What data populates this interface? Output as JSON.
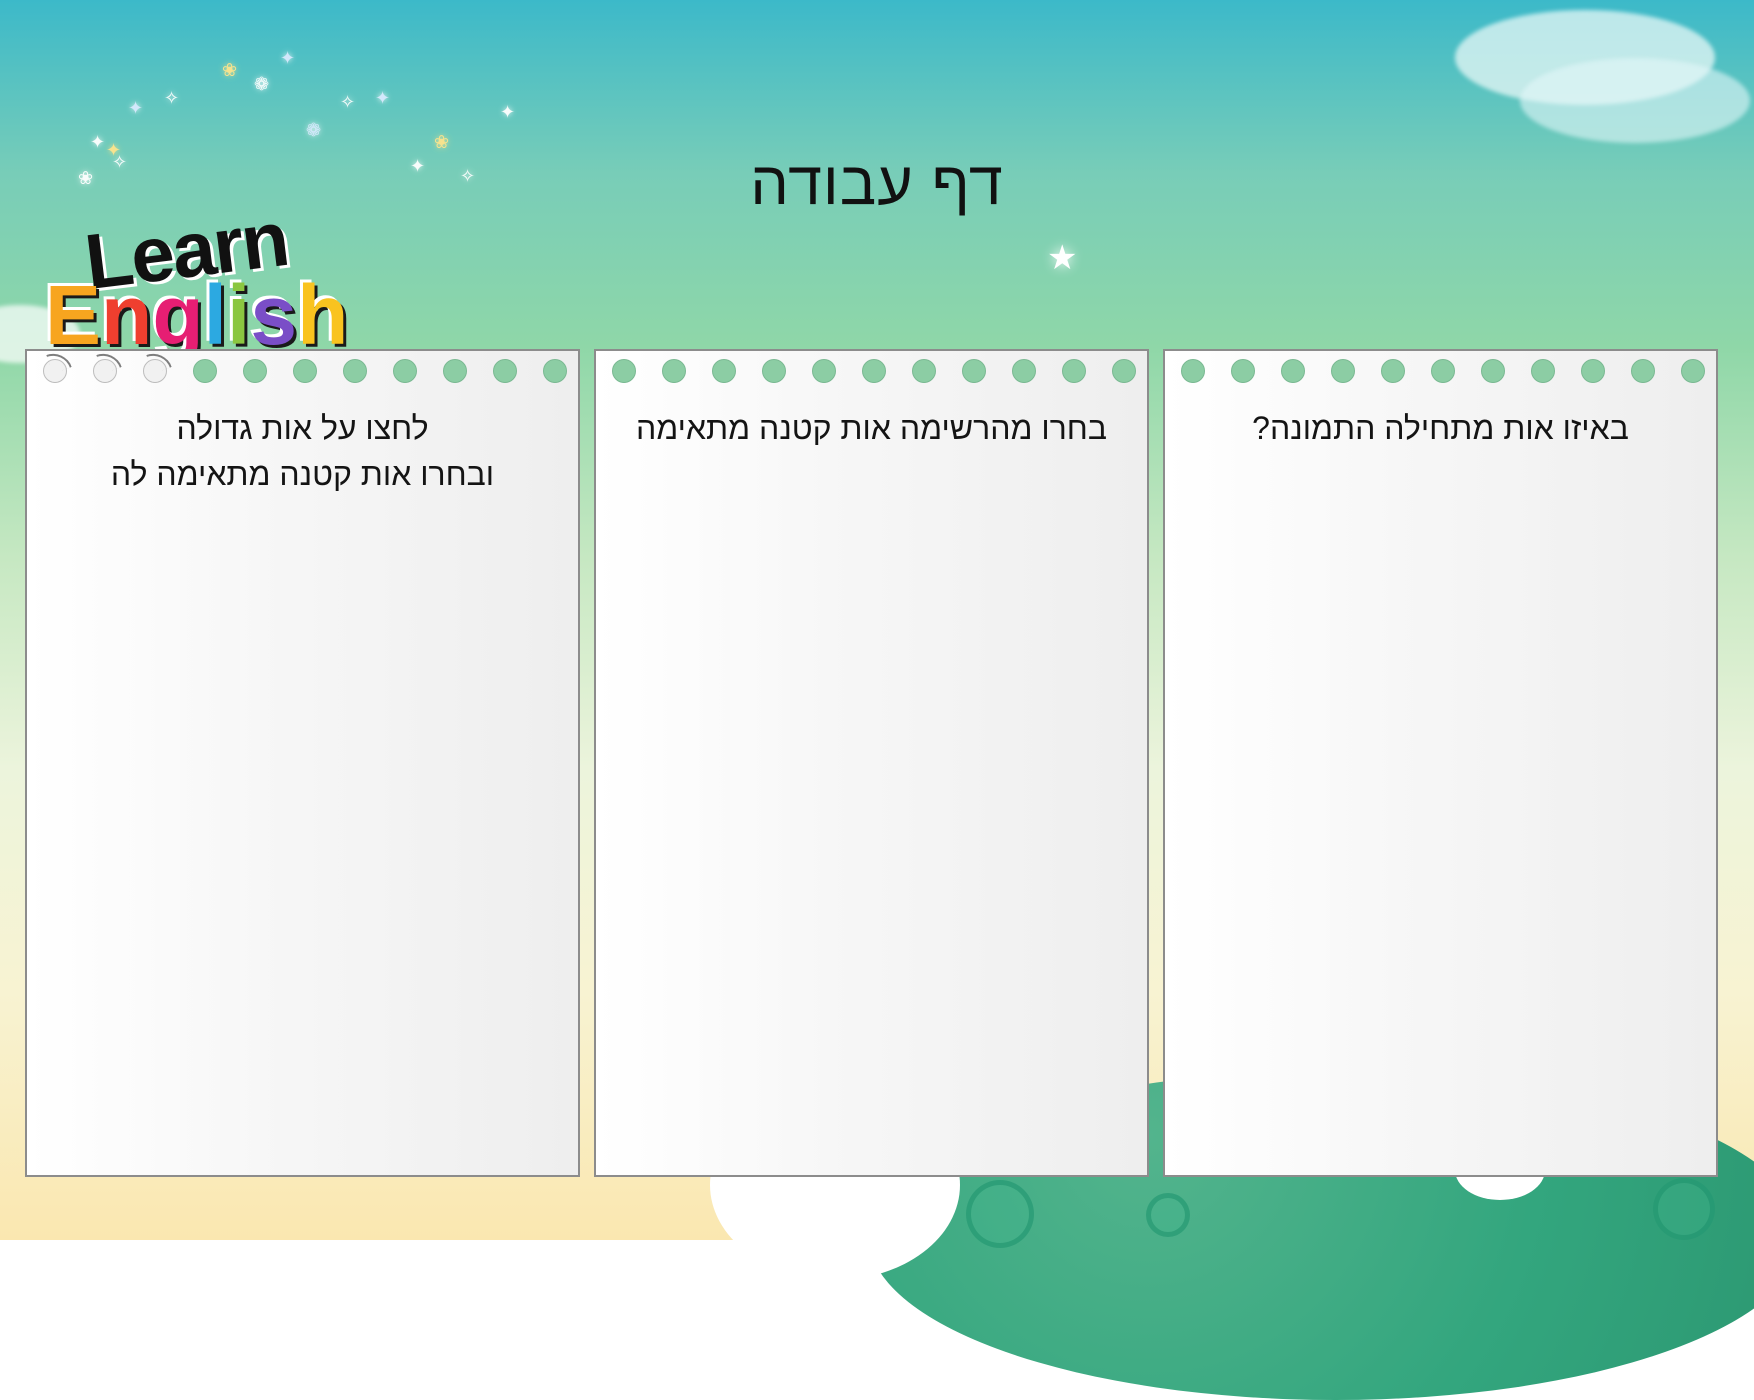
{
  "page": {
    "title": "דף עבודה"
  },
  "logo": {
    "learn": "Learn",
    "english_letters": [
      {
        "char": "E",
        "color": "#f7a51f"
      },
      {
        "char": "n",
        "color": "#ef3f2f"
      },
      {
        "char": "g",
        "color": "#e61e73"
      },
      {
        "char": "l",
        "color": "#2ca9e1"
      },
      {
        "char": "i",
        "color": "#8bc640"
      },
      {
        "char": "s",
        "color": "#7a4ec7"
      },
      {
        "char": "h",
        "color": "#f9c31f"
      }
    ]
  },
  "panels": [
    {
      "id": "right",
      "text": "באיזו אות מתחילה התמונה?"
    },
    {
      "id": "middle",
      "text": "בחרו מהרשימה אות קטנה מתאימה"
    },
    {
      "id": "left",
      "line1": "לחצו על אות גדולה",
      "line2": "ובחרו אות קטנה מתאימה לה"
    }
  ],
  "decorations": {
    "sparkles": [
      "✦",
      "✧",
      "❀",
      "❁",
      "✦",
      "✧",
      "✦",
      "❀",
      "✧",
      "✦",
      "❁",
      "✦",
      "✧",
      "✦",
      "❀",
      "✦"
    ],
    "star": "★"
  },
  "colors": {
    "hole_green": "#8ccda4",
    "panel_border": "#8c8c8c",
    "title": "#111111"
  }
}
